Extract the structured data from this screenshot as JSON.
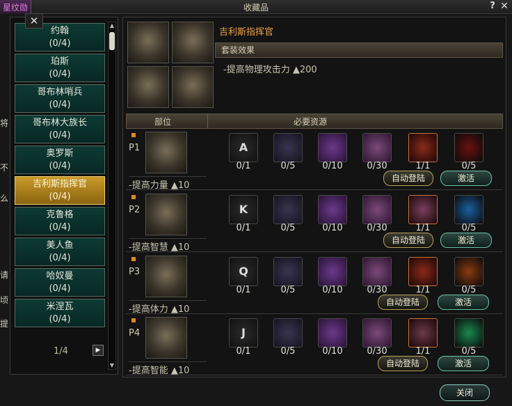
{
  "window": {
    "title": "收藏品",
    "prev_tab": "星纹勋",
    "help": "?",
    "close": "✕"
  },
  "side_glyphs": [
    "将",
    "不",
    "么",
    "请",
    "顷",
    "提"
  ],
  "list": {
    "items": [
      {
        "name": "约翰",
        "count": "(0/4)"
      },
      {
        "name": "珀斯",
        "count": "(0/4)"
      },
      {
        "name": "哥布林哨兵",
        "count": "(0/4)"
      },
      {
        "name": "哥布林大族长",
        "count": "(0/4)"
      },
      {
        "name": "奥罗斯",
        "count": "(0/4)"
      },
      {
        "name": "吉利斯指挥官",
        "count": "(0/4)"
      },
      {
        "name": "克鲁格",
        "count": "(0/4)"
      },
      {
        "name": "美人鱼",
        "count": "(0/4)"
      },
      {
        "name": "哈奴曼",
        "count": "(0/4)"
      },
      {
        "name": "米涅瓦",
        "count": "(0/4)"
      }
    ],
    "selected_index": 5,
    "page": "1/4",
    "small_close": "✕"
  },
  "detail": {
    "set_name": "吉利斯指挥官",
    "set_effect_label": "套装效果",
    "set_bonus": "-提高物理攻击力  ▲200",
    "col_part": "部位",
    "col_resources": "必要资源"
  },
  "rows": [
    {
      "label": "P1",
      "stat": "-提高力量 ▲10",
      "letter": "A",
      "counts": [
        "0/1",
        "0/5",
        "0/10",
        "0/30",
        "1/1",
        "0/5"
      ],
      "auto_btn": "自动登陆",
      "activate_btn": "激活"
    },
    {
      "label": "P2",
      "stat": "-提高智慧 ▲10",
      "letter": "K",
      "counts": [
        "0/1",
        "0/5",
        "0/10",
        "0/30",
        "1/1",
        "0/5"
      ],
      "auto_btn": "自动登陆",
      "activate_btn": "激活"
    },
    {
      "label": "P3",
      "stat": "-提高体力 ▲10",
      "letter": "Q",
      "counts": [
        "0/1",
        "0/5",
        "0/10",
        "0/30",
        "1/1",
        "0/5"
      ],
      "auto_btn": "自动登陆",
      "activate_btn": "激活"
    },
    {
      "label": "P4",
      "stat": "-提高智能 ▲10",
      "letter": "J",
      "counts": [
        "0/1",
        "0/5",
        "0/10",
        "0/30",
        "1/1",
        "0/5"
      ],
      "auto_btn": "自动登陆",
      "activate_btn": "激活"
    }
  ],
  "footer": {
    "close_label": "关闭"
  },
  "colors": {
    "accent_orange": "#f0a24a",
    "list_bg": "#0d3a33",
    "selected_gold": "#c89a2a"
  }
}
